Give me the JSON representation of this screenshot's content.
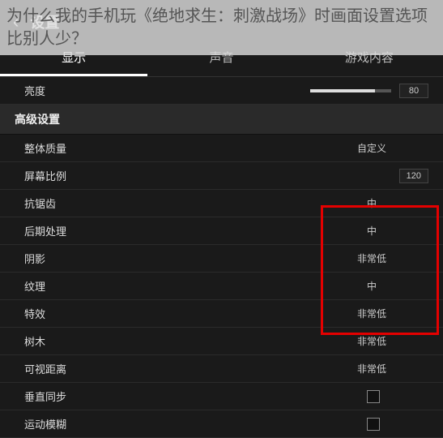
{
  "overlay_question": "为什么我的手机玩《绝地求生：刺激战场》时画面设置选项比别人少？",
  "header": {
    "back_icon": "‹",
    "title": "设置"
  },
  "tabs": {
    "display": "显示",
    "sound": "声音",
    "game_content": "游戏内容"
  },
  "rows": {
    "brightness": {
      "label": "亮度",
      "value": "80",
      "fill": 80
    },
    "advanced_header": "高级设置",
    "overall_quality": {
      "label": "整体质量",
      "value": "自定义"
    },
    "screen_ratio": {
      "label": "屏幕比例",
      "value": "120"
    },
    "anti_aliasing": {
      "label": "抗锯齿",
      "value": "中"
    },
    "post_processing": {
      "label": "后期处理",
      "value": "中"
    },
    "shadows": {
      "label": "阴影",
      "value": "非常低"
    },
    "texture": {
      "label": "纹理",
      "value": "中"
    },
    "effects": {
      "label": "特效",
      "value": "非常低"
    },
    "trees": {
      "label": "树木",
      "value": "非常低"
    },
    "view_distance": {
      "label": "可视距离",
      "value": "非常低"
    },
    "vsync": {
      "label": "垂直同步"
    },
    "motion_blur": {
      "label": "运动模糊"
    }
  }
}
